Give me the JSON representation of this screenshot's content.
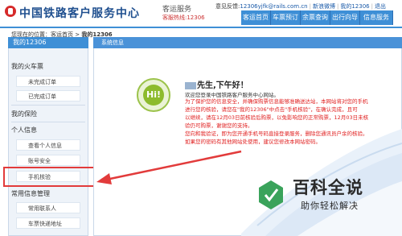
{
  "header": {
    "site_title": "中国铁路客户服务中心",
    "service_label": "客运服务",
    "hotline": "客服热线:12306",
    "feedback_label": "意见反馈:",
    "feedback_email": "12306yjfk@rails.com.cn",
    "wechat": "新浪微博",
    "mobile": "手机版",
    "my": "我的12306",
    "logout": "退出",
    "nav": [
      "客运首页",
      "车票预订",
      "余票查询",
      "出行向导",
      "信息服务"
    ]
  },
  "breadcrumb": {
    "prefix": "您现在的位置：客运首页 > ",
    "current": "我的12306"
  },
  "sidebar": {
    "title": "我的12306",
    "sections": [
      {
        "label": "我的火车票",
        "items": [
          "未完成订单",
          "已完成订单"
        ]
      },
      {
        "label": "我的保险",
        "items": []
      },
      {
        "label": "个人信息",
        "items": [
          "查看个人信息",
          "账号安全",
          "手机核验"
        ]
      },
      {
        "label": "常用信息管理",
        "items": [
          "常用联系人",
          "车票快递地址"
        ]
      }
    ]
  },
  "main": {
    "panel_title": "系统信息",
    "hi_badge": "Hi!",
    "greeting": "先生,下午好！",
    "welcome": "欢迎您登录中国铁路客户服务中心网站。",
    "notice_lines": [
      "为了保护您的信息安全，并确保购票信息能够准确送达站，本网站将对您的手机",
      "进行您的核验，请您在\"我的12306\"中点击\"手机核验\"，在确认完成，且可",
      "以继续，请在12月03日前核验后购票，以免影响您的正常购票，12月03日未核",
      "验仍可购票，谢谢您的支持。",
      "您向和我验证，即为您开通手机号码直接登录服务，删除您通讯员户余的核验。",
      "如果您的密码有其他网站处使用，建议您修改本网站密码。"
    ]
  },
  "watermark": {
    "title": "百科全说",
    "subtitle": "助你轻松解决"
  },
  "colors": {
    "accent": "#3e8fd6",
    "alert": "#e01f1f",
    "highlight_box": "#e23b3b",
    "badge": "#8dbb2d"
  }
}
